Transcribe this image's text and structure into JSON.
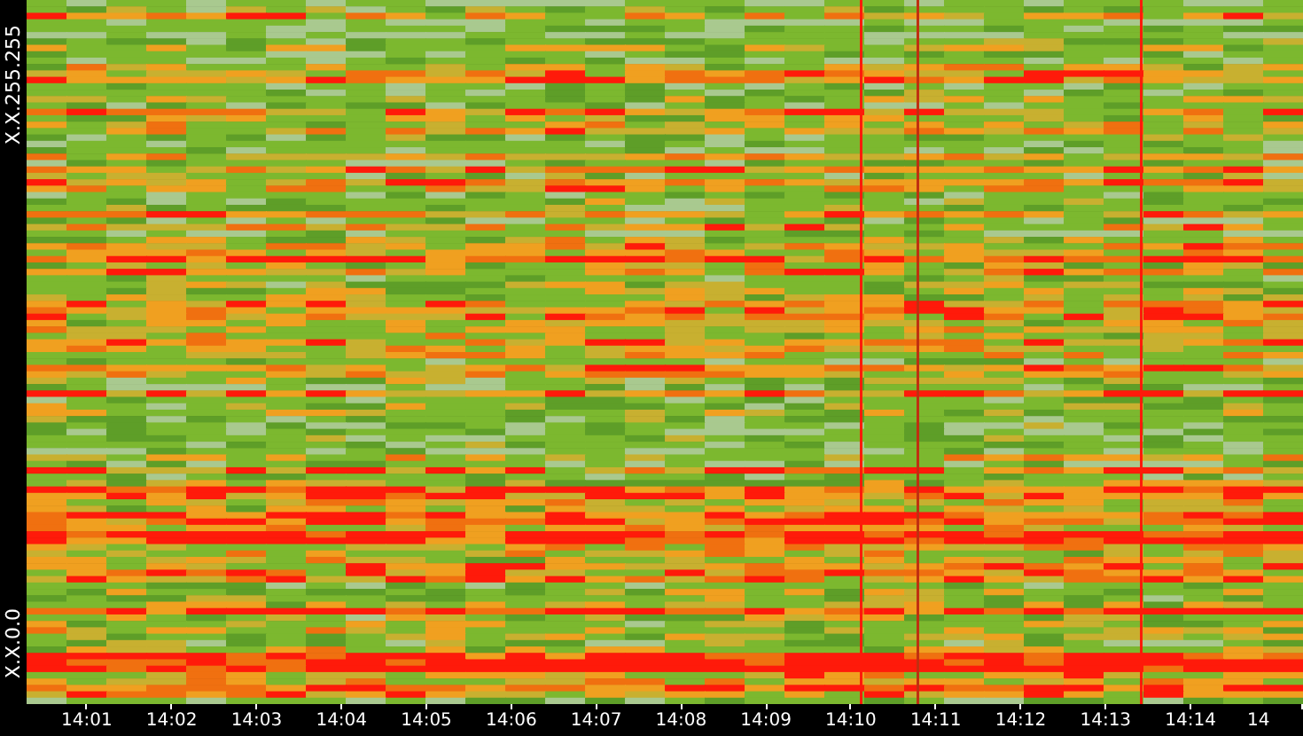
{
  "y_axis": {
    "top_label": "X.X.255.255",
    "bottom_label": "X.X.0.0"
  },
  "x_axis": {
    "ticks": [
      "14:01",
      "14:02",
      "14:03",
      "14:04",
      "14:05",
      "14:06",
      "14:07",
      "14:08",
      "14:09",
      "14:10",
      "14:11",
      "14:12",
      "14:13",
      "14:14",
      "14"
    ]
  }
}
